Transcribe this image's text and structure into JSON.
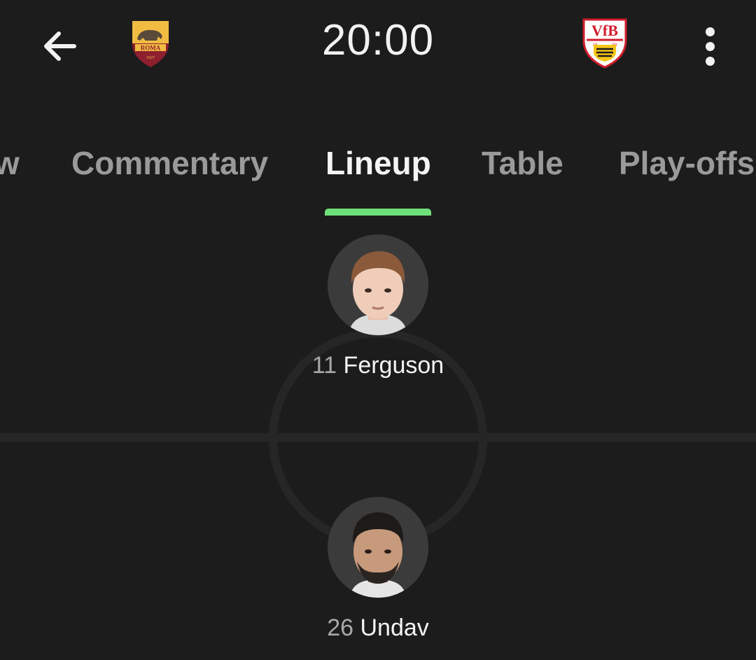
{
  "header": {
    "match_time": "20:00",
    "home_team": {
      "crest_icon": "as-roma-crest-icon",
      "crest_text": "ROMA",
      "crest_year": "1927"
    },
    "away_team": {
      "crest_icon": "vfb-stuttgart-crest-icon",
      "crest_text": "VfB",
      "crest_years": [
        "18",
        "93"
      ]
    },
    "back_icon": "arrow-left-icon",
    "menu_icon": "more-vertical-icon"
  },
  "tabs": [
    {
      "label": "w",
      "active": false
    },
    {
      "label": "Commentary",
      "active": false
    },
    {
      "label": "Lineup",
      "active": true
    },
    {
      "label": "Table",
      "active": false
    },
    {
      "label": "Play-offs",
      "active": false
    }
  ],
  "colors": {
    "background": "#1c1c1c",
    "active_tab_indicator": "#6ee07a",
    "pitch_lines": "#262626",
    "inactive_tab": "#9a9a9a"
  },
  "lineup": {
    "home_players": [
      {
        "number": "11",
        "name": "Ferguson"
      }
    ],
    "away_players": [
      {
        "number": "26",
        "name": "Undav"
      }
    ]
  }
}
